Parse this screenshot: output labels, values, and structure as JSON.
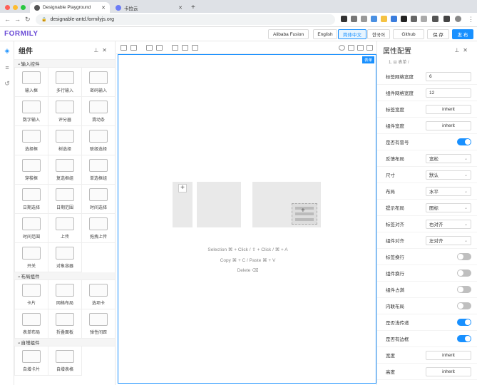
{
  "browser": {
    "active_tab": "Designable Playground",
    "inactive_tab": "卡拉云",
    "url": "designable-antd.formilyjs.org"
  },
  "app": {
    "logo": "FORMILY",
    "buttons": [
      "Alibaba Fusion",
      "English",
      "简体中文",
      "한국어",
      "Github",
      "保 存",
      "发 布"
    ]
  },
  "left_panel": {
    "title": "组件",
    "groups": [
      {
        "label": "输入控件",
        "items": [
          "输入框",
          "多行输入",
          "密码输入",
          "数字输入",
          "评分器",
          "滑动条",
          "选择框",
          "树选择",
          "联级选择",
          "穿梭框",
          "复选框组",
          "单选框组",
          "日期选择",
          "日期范围",
          "时间选择",
          "时间范围",
          "上传",
          "拖拽上传",
          "开关",
          "对象容器"
        ]
      },
      {
        "label": "布局组件",
        "items": [
          "卡片",
          "网格布局",
          "选项卡",
          "表单布局",
          "折叠面板",
          "弹性间距"
        ]
      },
      {
        "label": "自增组件",
        "items": [
          "自增卡片",
          "自增表格"
        ]
      }
    ]
  },
  "canvas": {
    "badge": "表单",
    "hints": [
      "Selection ⌘ + Click / ⇧ + Click / ⌘ + A",
      "Copy ⌘ + C / Paste ⌘ + V",
      "Delete ⌫"
    ]
  },
  "right_panel": {
    "title": "属性配置",
    "breadcrumb": "1. ⊟ 表单 /",
    "rows": [
      {
        "label": "标签网格宽度",
        "type": "input",
        "value": "6"
      },
      {
        "label": "组件网格宽度",
        "type": "input",
        "value": "12"
      },
      {
        "label": "标签宽度",
        "type": "inherit",
        "value": "inherit"
      },
      {
        "label": "组件宽度",
        "type": "inherit",
        "value": "inherit"
      },
      {
        "label": "是否有冒号",
        "type": "switch",
        "on": true
      },
      {
        "label": "反馈布局",
        "type": "select",
        "value": "宽松"
      },
      {
        "label": "尺寸",
        "type": "select",
        "value": "默认"
      },
      {
        "label": "布局",
        "type": "select",
        "value": "水平"
      },
      {
        "label": "提示布局",
        "type": "select",
        "value": "图标"
      },
      {
        "label": "标签对齐",
        "type": "select",
        "value": "右对齐"
      },
      {
        "label": "组件对齐",
        "type": "select",
        "value": "左对齐"
      },
      {
        "label": "标签换行",
        "type": "switch",
        "on": false
      },
      {
        "label": "组件换行",
        "type": "switch",
        "on": false
      },
      {
        "label": "组件占满",
        "type": "switch",
        "on": false
      },
      {
        "label": "内联布局",
        "type": "switch",
        "on": false
      },
      {
        "label": "是否浅传递",
        "type": "switch",
        "on": true
      },
      {
        "label": "是否有边框",
        "type": "switch",
        "on": true
      },
      {
        "label": "宽度",
        "type": "inherit",
        "value": "inherit"
      },
      {
        "label": "高度",
        "type": "inherit",
        "value": "inherit"
      }
    ]
  }
}
